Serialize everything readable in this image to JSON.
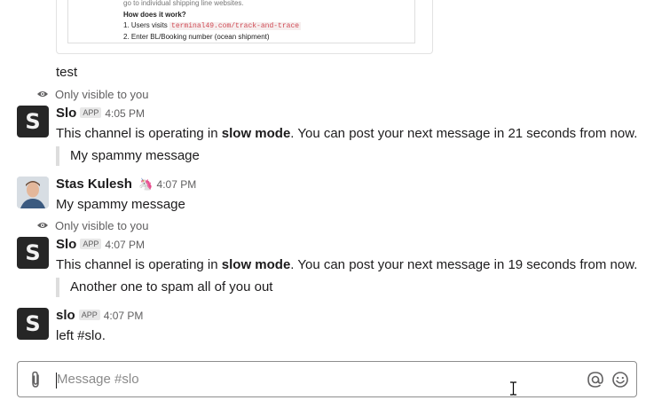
{
  "preview_card": {
    "line1": "go to individual shipping line websites.",
    "heading": "How does it work?",
    "step1_prefix": "1.  Users visits",
    "step1_code": "terminal49.com/track-and-trace",
    "step2": "2.  Enter  BL/Booking number (ocean shipment)"
  },
  "messages": [
    {
      "text": "test"
    },
    {
      "ephemeral": "Only visible to you"
    },
    {
      "author": "Slo",
      "badge": "APP",
      "time": "4:05 PM",
      "text_before": "This channel is operating in ",
      "text_bold": "slow mode",
      "text_after": ". You can post your next message in 21 seconds from now.",
      "quote": "My spammy message"
    },
    {
      "author": "Stas Kulesh",
      "time": "4:07 PM",
      "emoji": "🦄",
      "text": "My spammy message"
    },
    {
      "ephemeral": "Only visible to you"
    },
    {
      "author": "Slo",
      "badge": "APP",
      "time": "4:07 PM",
      "text_before": "This channel is operating in ",
      "text_bold": "slow mode",
      "text_after": ". You can post your next message in 19 seconds from now.",
      "quote": "Another one to spam all of you out"
    },
    {
      "author": "slo",
      "badge": "APP",
      "time": "4:07 PM",
      "text": "left #slo."
    }
  ],
  "avatar_letter": "S",
  "composer": {
    "placeholder": "Message #slo"
  },
  "icons": {
    "eye": "eye-icon",
    "attach": "paperclip-icon",
    "mention": "at-icon",
    "emoji": "smiley-icon"
  }
}
